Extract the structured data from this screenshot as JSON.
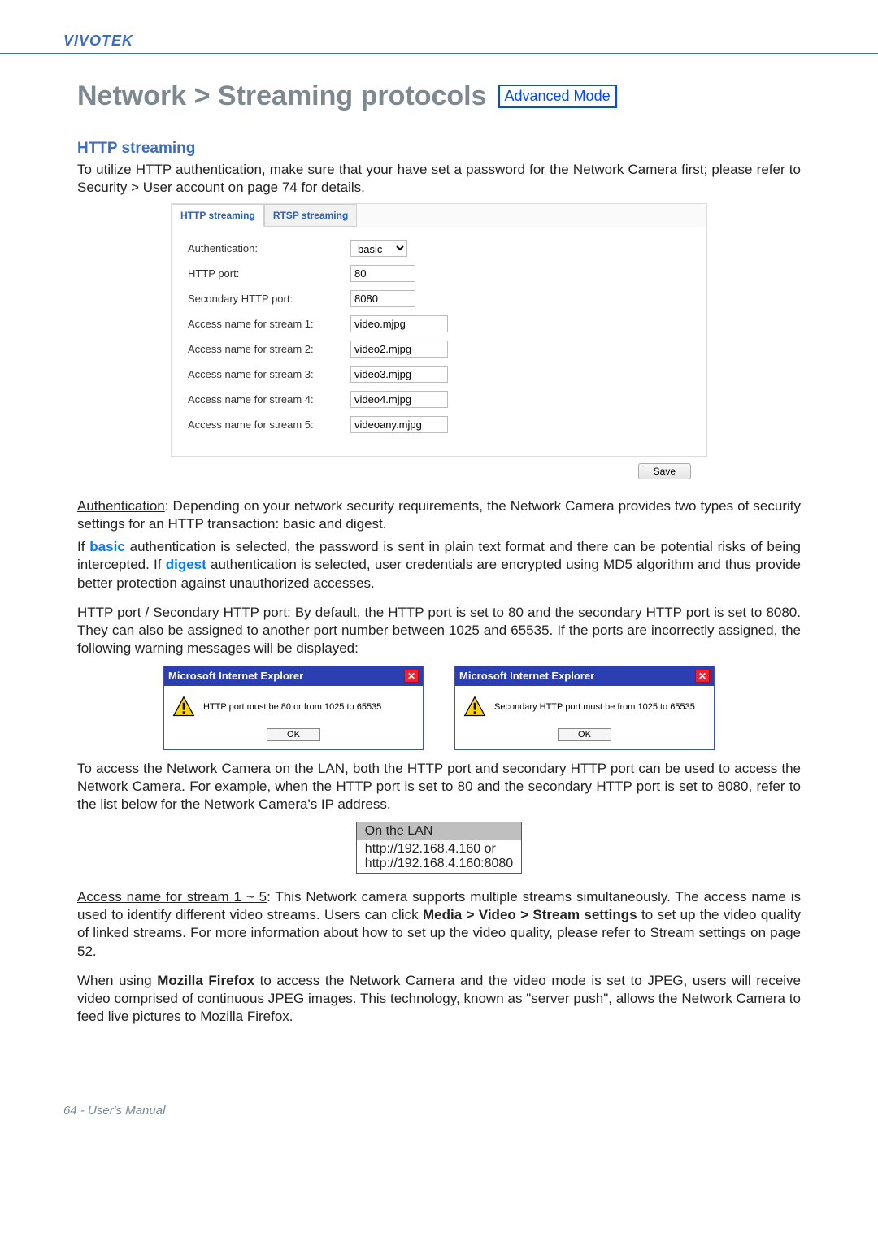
{
  "brand": "VIVOTEK",
  "page_title": "Network > Streaming protocols",
  "mode_badge": "Advanced Mode",
  "section_heading": "HTTP streaming",
  "intro_text": "To utilize HTTP authentication, make sure that your have set a password for the Network Camera first; please refer to Security > User account on page 74 for details.",
  "tabs": {
    "http": "HTTP streaming",
    "rtsp": "RTSP streaming"
  },
  "form": {
    "auth_label": "Authentication:",
    "auth_value": "basic",
    "http_port_label": "HTTP port:",
    "http_port_value": "80",
    "sec_port_label": "Secondary HTTP port:",
    "sec_port_value": "8080",
    "s1_label": "Access name for stream 1:",
    "s1_value": "video.mjpg",
    "s2_label": "Access name for stream 2:",
    "s2_value": "video2.mjpg",
    "s3_label": "Access name for stream 3:",
    "s3_value": "video3.mjpg",
    "s4_label": "Access name for stream 4:",
    "s4_value": "video4.mjpg",
    "s5_label": "Access name for stream 5:",
    "s5_value": "videoany.mjpg"
  },
  "save_btn": "Save",
  "auth_para_prefix": "Authentication",
  "auth_para_rest": ": Depending on your network security requirements, the Network Camera provides two types of security settings for an HTTP transaction: basic and digest.",
  "auth_para2_if": "If ",
  "auth_para2_basic": "basic",
  "auth_para2_mid": " authentication is selected, the password is sent in plain text format and there can be potential risks of being intercepted. If ",
  "auth_para2_digest": "digest",
  "auth_para2_end": " authentication is selected, user credentials are encrypted using MD5 algorithm and thus provide better protection against unauthorized accesses.",
  "port_para_under": "HTTP port / Secondary HTTP port",
  "port_para_rest": ": By default, the HTTP port is set to 80 and the secondary HTTP port is set to 8080. They can also be assigned to another port number between 1025 and 65535. If the ports are incorrectly assigned, the following warning messages will be displayed:",
  "dialog": {
    "title": "Microsoft Internet Explorer",
    "msg1": "HTTP port must be 80 or from 1025 to 65535",
    "msg2": "Secondary HTTP port must be from 1025 to 65535",
    "ok": "OK"
  },
  "lan_access_para": "To access the Network Camera on the LAN, both the HTTP port and secondary HTTP port can be used to access the Network Camera. For example, when the HTTP port is set to 80 and the secondary HTTP port is set to 8080, refer to the list below for the Network Camera's IP address.",
  "lan_table": {
    "header": "On the LAN",
    "line1": "http://192.168.4.160  or",
    "line2": "http://192.168.4.160:8080"
  },
  "access_under": "Access name for stream 1 ~ 5",
  "access_rest1": ": This Network camera supports multiple streams simultaneously. The access name is used to identify different video streams. Users can click ",
  "access_bold": "Media > Video > Stream settings",
  "access_rest2": " to set up the video quality of linked streams. For more information about how to set up the video quality, please refer to Stream settings on page 52.",
  "firefox_p1": "When using ",
  "firefox_bold": "Mozilla Firefox",
  "firefox_p2": " to access the Network Camera and the video mode is set to JPEG, users will receive video comprised of continuous JPEG images. This technology, known as \"server push\", allows the Network Camera to feed live pictures to Mozilla Firefox.",
  "footer": "64 - User's Manual"
}
